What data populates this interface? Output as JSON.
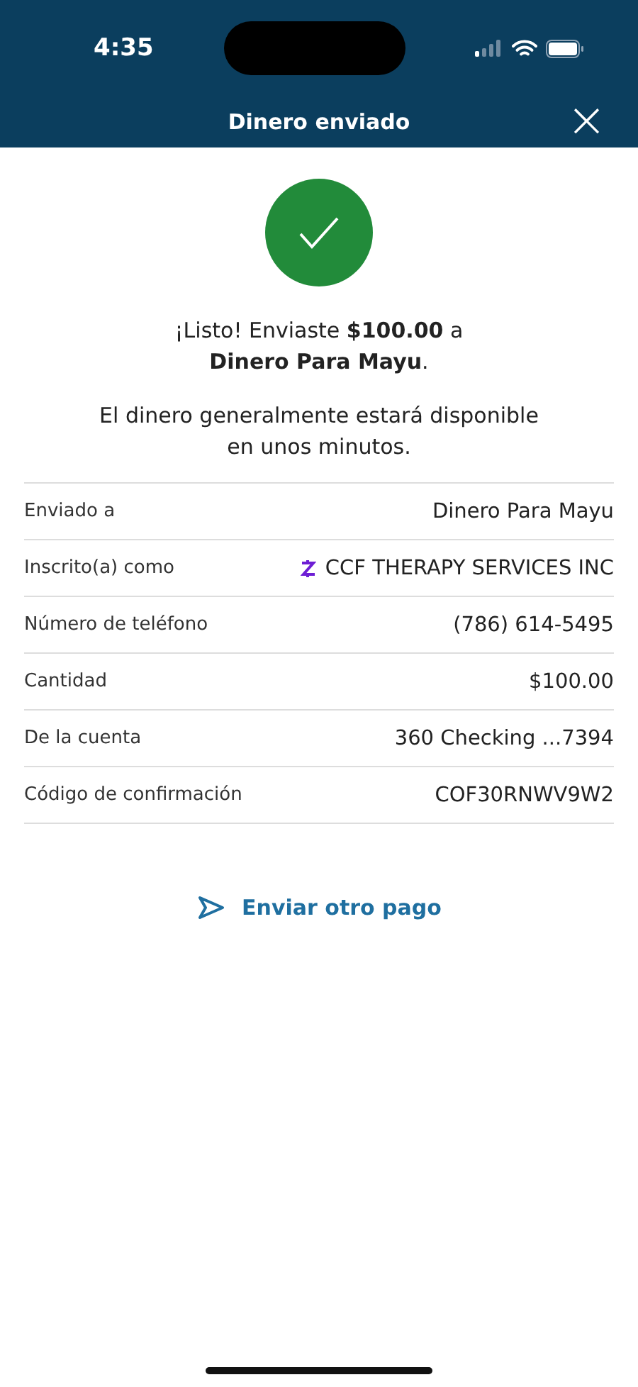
{
  "status_bar": {
    "time": "4:35"
  },
  "header": {
    "title": "Dinero enviado",
    "close": "×"
  },
  "message": {
    "headline": "¡Listo! Enviaste **$100.00** a **Dinero Para Mayu**.",
    "note": "El dinero generalmente estará disponible en unos minutos."
  },
  "details": [
    {
      "kind": "plain",
      "label": "Enviado a",
      "value": "Dinero Para Mayu"
    },
    {
      "kind": "badge",
      "label": "Inscrito(a) como",
      "value": "CCF THERAPY SERVICES INC"
    },
    {
      "kind": "plain",
      "label": "Número de teléfono",
      "value": "(786) 614-5495"
    },
    {
      "kind": "plain",
      "label": "Cantidad",
      "value": "$100.00"
    },
    {
      "kind": "plain",
      "label": "De la cuenta",
      "value": "360 Checking ...7394"
    },
    {
      "kind": "plain",
      "label": "Código de confirmación",
      "value": "COF30RNWV9W2"
    }
  ],
  "action": {
    "label": "Enviar otro pago"
  }
}
